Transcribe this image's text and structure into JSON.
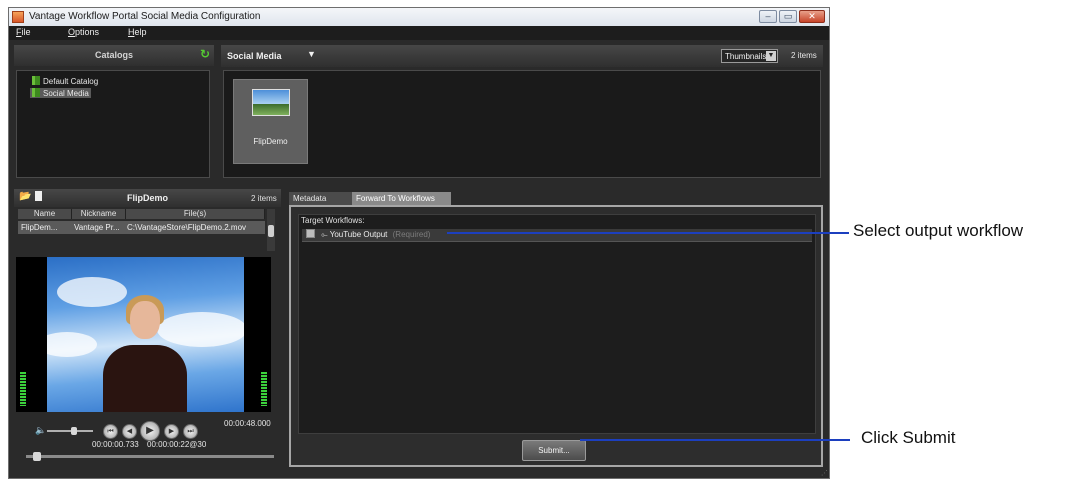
{
  "window": {
    "title": "Vantage Workflow Portal Social Media Configuration",
    "controls": {
      "minimize": "–",
      "maximize": "▭",
      "close": "✕"
    }
  },
  "menu": {
    "items": [
      "File",
      "Options",
      "Help"
    ]
  },
  "catalogs": {
    "title": "Catalogs",
    "refresh_icon": "refresh-icon",
    "items": [
      "Default Catalog",
      "Social Media"
    ],
    "selected": "Social Media"
  },
  "media": {
    "title": "Social Media",
    "view_mode": "Thumbnails",
    "count": "2 items",
    "thumbnail_label": "FlipDemo"
  },
  "clip": {
    "title": "FlipDemo",
    "count": "2 items",
    "columns": [
      "Name",
      "Nickname",
      "File(s)"
    ],
    "row": {
      "name": "FlipDem...",
      "nickname": "Vantage Pr...",
      "file": "C:\\VantageStore\\FlipDemo.2.mov"
    }
  },
  "player": {
    "duration": "00:00:48.000",
    "position": "00:00:00.733",
    "timecode": "00:00:00:22@30",
    "progress_fraction": 0.03,
    "volume_fraction": 0.6
  },
  "tabs": {
    "items": [
      "Metadata Labels",
      "Forward To Workflows"
    ],
    "active": "Forward To Workflows"
  },
  "workflows": {
    "header": "Target Workflows:",
    "rows": [
      {
        "name": "YouTube Output",
        "note": "(Required)"
      }
    ]
  },
  "submit_label": "Submit...",
  "annotations": {
    "select": "Select output workflow",
    "submit": "Click Submit"
  },
  "colors": {
    "annotation_line": "#1c3fbf",
    "accent_green": "#6bbf3a"
  }
}
